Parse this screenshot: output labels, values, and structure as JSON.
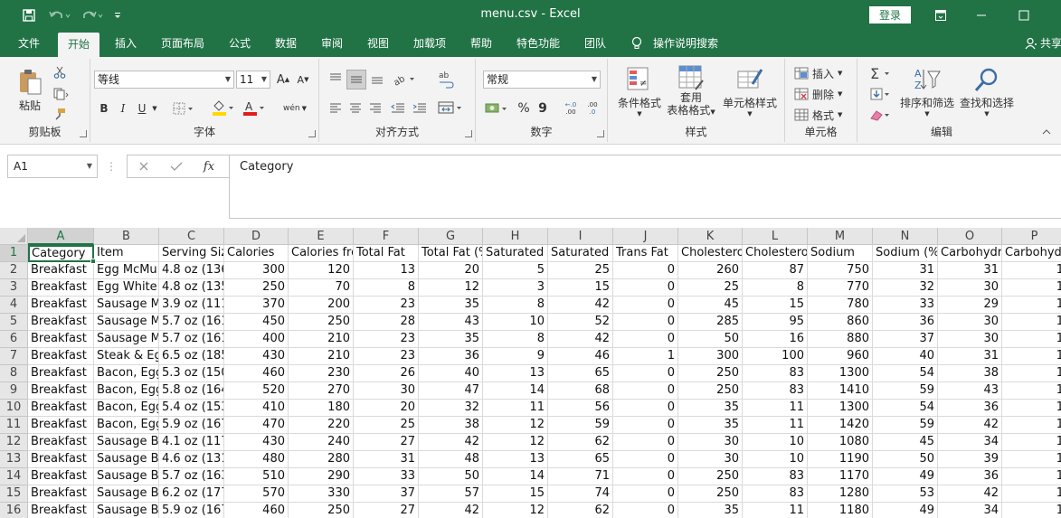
{
  "window": {
    "title": "menu.csv  -  Excel",
    "login_label": "登录"
  },
  "tabs": [
    {
      "label": "文件"
    },
    {
      "label": "开始"
    },
    {
      "label": "插入"
    },
    {
      "label": "页面布局"
    },
    {
      "label": "公式"
    },
    {
      "label": "数据"
    },
    {
      "label": "审阅"
    },
    {
      "label": "视图"
    },
    {
      "label": "加载项"
    },
    {
      "label": "帮助"
    },
    {
      "label": "特色功能"
    },
    {
      "label": "团队"
    },
    {
      "label": "操作说明搜索"
    },
    {
      "label": "共享"
    }
  ],
  "ribbon": {
    "clipboard": {
      "label": "剪贴板",
      "paste": "粘贴"
    },
    "font": {
      "label": "字体",
      "family": "等线",
      "size": "11",
      "bold": "B",
      "italic": "I",
      "underline": "U",
      "grow": "A",
      "shrink": "A",
      "phonetic": "wén"
    },
    "alignment": {
      "label": "对齐方式"
    },
    "number": {
      "label": "数字",
      "format": "常规",
      "percent": "%",
      "comma": "9",
      "inc_decimal": ".00",
      "dec_decimal": ".0"
    },
    "styles": {
      "label": "样式",
      "conditional": "条件格式",
      "table_line1": "套用",
      "table_line2": "表格格式",
      "cell_styles": "单元格样式"
    },
    "cells": {
      "label": "单元格",
      "insert": "插入",
      "delete": "删除",
      "format": "格式"
    },
    "editing": {
      "label": "编辑",
      "sort": "排序和筛选",
      "find": "查找和选择"
    }
  },
  "formula_bar": {
    "name_box": "A1",
    "fx": "fx",
    "content": "Category"
  },
  "sheet": {
    "columns": [
      "A",
      "B",
      "C",
      "D",
      "E",
      "F",
      "G",
      "H",
      "I",
      "J",
      "K",
      "L",
      "M",
      "N",
      "O",
      "P"
    ],
    "header_row": [
      "Category",
      "Item",
      "Serving Siz",
      "Calories",
      "Calories fro",
      "Total Fat",
      "Total Fat (%",
      "Saturated",
      "Saturated",
      "Trans Fat",
      "Cholestero",
      "Cholestero",
      "Sodium",
      "Sodium (%",
      "Carbohydr",
      "Carbohyd"
    ],
    "rows": [
      {
        "n": "2",
        "c": [
          "Breakfast",
          "Egg McMu",
          "4.8 oz (136",
          "300",
          "120",
          "13",
          "20",
          "5",
          "25",
          "0",
          "260",
          "87",
          "750",
          "31",
          "31",
          "1"
        ]
      },
      {
        "n": "3",
        "c": [
          "Breakfast",
          "Egg White",
          "4.8 oz (135",
          "250",
          "70",
          "8",
          "12",
          "3",
          "15",
          "0",
          "25",
          "8",
          "770",
          "32",
          "30",
          "1"
        ]
      },
      {
        "n": "4",
        "c": [
          "Breakfast",
          "Sausage M",
          "3.9 oz (111",
          "370",
          "200",
          "23",
          "35",
          "8",
          "42",
          "0",
          "45",
          "15",
          "780",
          "33",
          "29",
          "1"
        ]
      },
      {
        "n": "5",
        "c": [
          "Breakfast",
          "Sausage M",
          "5.7 oz (161",
          "450",
          "250",
          "28",
          "43",
          "10",
          "52",
          "0",
          "285",
          "95",
          "860",
          "36",
          "30",
          "1"
        ]
      },
      {
        "n": "6",
        "c": [
          "Breakfast",
          "Sausage M",
          "5.7 oz (161",
          "400",
          "210",
          "23",
          "35",
          "8",
          "42",
          "0",
          "50",
          "16",
          "880",
          "37",
          "30",
          "1"
        ]
      },
      {
        "n": "7",
        "c": [
          "Breakfast",
          "Steak & Eg",
          "6.5 oz (185",
          "430",
          "210",
          "23",
          "36",
          "9",
          "46",
          "1",
          "300",
          "100",
          "960",
          "40",
          "31",
          "1"
        ]
      },
      {
        "n": "8",
        "c": [
          "Breakfast",
          "Bacon, Egg",
          "5.3 oz (150",
          "460",
          "230",
          "26",
          "40",
          "13",
          "65",
          "0",
          "250",
          "83",
          "1300",
          "54",
          "38",
          "1"
        ]
      },
      {
        "n": "9",
        "c": [
          "Breakfast",
          "Bacon, Egg",
          "5.8 oz (164",
          "520",
          "270",
          "30",
          "47",
          "14",
          "68",
          "0",
          "250",
          "83",
          "1410",
          "59",
          "43",
          "1"
        ]
      },
      {
        "n": "10",
        "c": [
          "Breakfast",
          "Bacon, Egg",
          "5.4 oz (153",
          "410",
          "180",
          "20",
          "32",
          "11",
          "56",
          "0",
          "35",
          "11",
          "1300",
          "54",
          "36",
          "1"
        ]
      },
      {
        "n": "11",
        "c": [
          "Breakfast",
          "Bacon, Egg",
          "5.9 oz (167",
          "470",
          "220",
          "25",
          "38",
          "12",
          "59",
          "0",
          "35",
          "11",
          "1420",
          "59",
          "42",
          "1"
        ]
      },
      {
        "n": "12",
        "c": [
          "Breakfast",
          "Sausage Bi",
          "4.1 oz (117",
          "430",
          "240",
          "27",
          "42",
          "12",
          "62",
          "0",
          "30",
          "10",
          "1080",
          "45",
          "34",
          "1"
        ]
      },
      {
        "n": "13",
        "c": [
          "Breakfast",
          "Sausage Bi",
          "4.6 oz (131",
          "480",
          "280",
          "31",
          "48",
          "13",
          "65",
          "0",
          "30",
          "10",
          "1190",
          "50",
          "39",
          "1"
        ]
      },
      {
        "n": "14",
        "c": [
          "Breakfast",
          "Sausage Bi",
          "5.7 oz (163",
          "510",
          "290",
          "33",
          "50",
          "14",
          "71",
          "0",
          "250",
          "83",
          "1170",
          "49",
          "36",
          "1"
        ]
      },
      {
        "n": "15",
        "c": [
          "Breakfast",
          "Sausage Bi",
          "6.2 oz (177",
          "570",
          "330",
          "37",
          "57",
          "15",
          "74",
          "0",
          "250",
          "83",
          "1280",
          "53",
          "42",
          "1"
        ]
      },
      {
        "n": "16",
        "c": [
          "Breakfast",
          "Sausage Bi",
          "5.9 oz (167",
          "460",
          "250",
          "27",
          "42",
          "12",
          "62",
          "0",
          "35",
          "11",
          "1180",
          "49",
          "34",
          "1"
        ]
      }
    ]
  },
  "colors": {
    "excel_green": "#217346",
    "ribbon_bg": "#f3f3f3"
  }
}
